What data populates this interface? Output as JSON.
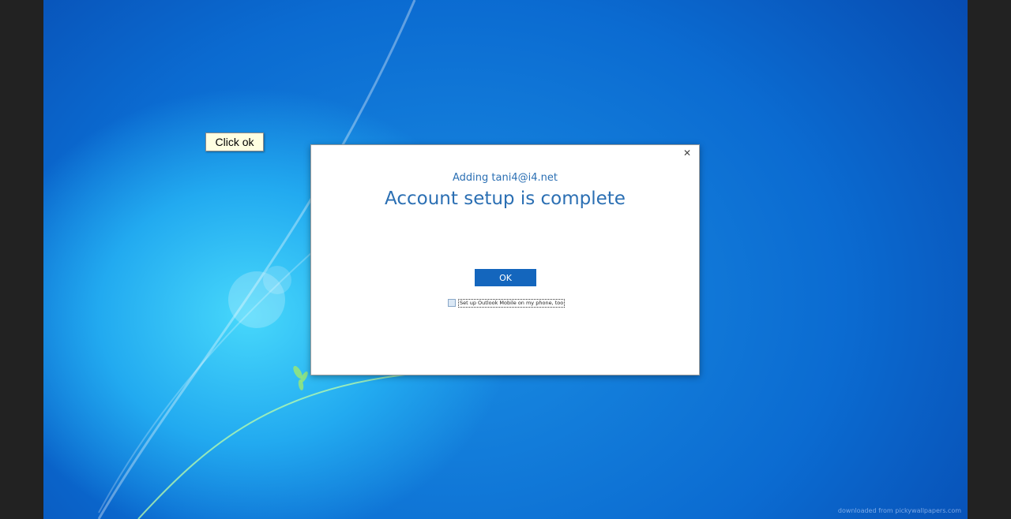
{
  "tooltip": {
    "text": "Click ok"
  },
  "dialog": {
    "subtitle": "Adding tani4@i4.net",
    "title": "Account setup is complete",
    "ok_label": "OK",
    "checkbox_label": "Set up Outlook Mobile on my phone, too",
    "checkbox_checked": false,
    "close_icon": "close-icon"
  },
  "watermark": "downloaded from pickywallpapers.com",
  "colors": {
    "accent": "#2b6fb3",
    "button": "#1466bd",
    "tooltip_bg": "#ffffe1"
  }
}
